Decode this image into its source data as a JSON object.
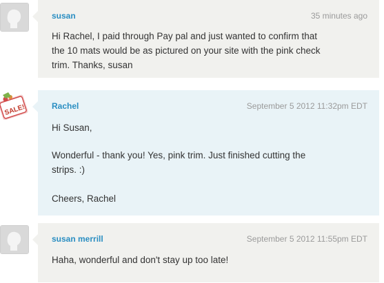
{
  "comments": [
    {
      "author": "susan",
      "time": "35 minutes ago",
      "lines": [
        "Hi Rachel, I paid through Pay pal and just wanted to confirm that",
        "the 10 mats would be as pictured on your site with the pink check",
        "trim. Thanks, susan"
      ],
      "avatar": "default-user-icon"
    },
    {
      "author": "Rachel",
      "time": "September 5 2012 11:32pm EDT",
      "greeting": "Hi Susan,",
      "lines": [
        "Wonderful - thank you! Yes, pink trim. Just finished cutting the",
        "strips. :)"
      ],
      "signoff": "Cheers, Rachel",
      "avatar": "sale-tag-icon",
      "avatar_text": "SALE!"
    },
    {
      "author": "susan merrill",
      "time": "September 5 2012 11:55pm EDT",
      "lines": [
        "Haha, wonderful and don't stay up too late!"
      ],
      "avatar": "default-user-icon"
    }
  ],
  "colors": {
    "author_link": "#2a8ec2",
    "grey_bubble": "#f1f1ee",
    "blue_bubble": "#e9f3f7",
    "timestamp": "#9a9a9a"
  }
}
